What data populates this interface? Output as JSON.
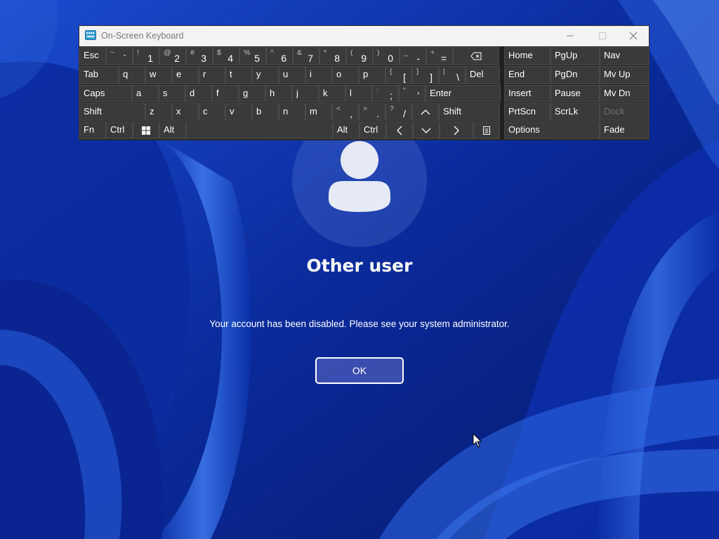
{
  "window": {
    "title": "On-Screen Keyboard",
    "icon": "keyboard-icon",
    "controls": [
      "minimize-icon",
      "maximize-icon",
      "close-icon"
    ]
  },
  "keyboard": {
    "rows": [
      [
        {
          "id": "esc",
          "label": "Esc"
        },
        {
          "id": "backtick",
          "shift": "~",
          "label": "`"
        },
        {
          "id": "1",
          "shift": "!",
          "label": "1"
        },
        {
          "id": "2",
          "shift": "@",
          "label": "2"
        },
        {
          "id": "3",
          "shift": "#",
          "label": "3"
        },
        {
          "id": "4",
          "shift": "$",
          "label": "4"
        },
        {
          "id": "5",
          "shift": "%",
          "label": "5"
        },
        {
          "id": "6",
          "shift": "^",
          "label": "6"
        },
        {
          "id": "7",
          "shift": "&",
          "label": "7"
        },
        {
          "id": "8",
          "shift": "*",
          "label": "8"
        },
        {
          "id": "9",
          "shift": "(",
          "label": "9"
        },
        {
          "id": "0",
          "shift": ")",
          "label": "0"
        },
        {
          "id": "minus",
          "shift": "_",
          "label": "-"
        },
        {
          "id": "equals",
          "shift": "+",
          "label": "="
        },
        {
          "id": "backspace",
          "icon": "backspace-icon"
        },
        {
          "id": "home",
          "label": "Home"
        },
        {
          "id": "pgup",
          "label": "PgUp"
        },
        {
          "id": "nav",
          "label": "Nav"
        }
      ],
      [
        {
          "id": "tab",
          "label": "Tab"
        },
        {
          "id": "q",
          "label": "q"
        },
        {
          "id": "w",
          "label": "w"
        },
        {
          "id": "e",
          "label": "e"
        },
        {
          "id": "r",
          "label": "r"
        },
        {
          "id": "t",
          "label": "t"
        },
        {
          "id": "y",
          "label": "y"
        },
        {
          "id": "u",
          "label": "u"
        },
        {
          "id": "i",
          "label": "i"
        },
        {
          "id": "o",
          "label": "o"
        },
        {
          "id": "p",
          "label": "p"
        },
        {
          "id": "lbracket",
          "shift": "{",
          "label": "["
        },
        {
          "id": "rbracket",
          "shift": "}",
          "label": "]"
        },
        {
          "id": "backslash",
          "shift": "|",
          "label": "\\"
        },
        {
          "id": "del",
          "label": "Del"
        },
        {
          "id": "end",
          "label": "End"
        },
        {
          "id": "pgdn",
          "label": "PgDn"
        },
        {
          "id": "mvup",
          "label": "Mv Up"
        }
      ],
      [
        {
          "id": "caps",
          "label": "Caps"
        },
        {
          "id": "a",
          "label": "a"
        },
        {
          "id": "s",
          "label": "s"
        },
        {
          "id": "d",
          "label": "d"
        },
        {
          "id": "f",
          "label": "f"
        },
        {
          "id": "g",
          "label": "g"
        },
        {
          "id": "h",
          "label": "h"
        },
        {
          "id": "j",
          "label": "j"
        },
        {
          "id": "k",
          "label": "k"
        },
        {
          "id": "l",
          "label": "l"
        },
        {
          "id": "semicolon",
          "shift": ":",
          "label": ";"
        },
        {
          "id": "quote",
          "shift": "\"",
          "label": "'"
        },
        {
          "id": "enter",
          "label": "Enter"
        },
        {
          "id": "insert",
          "label": "Insert"
        },
        {
          "id": "pause",
          "label": "Pause"
        },
        {
          "id": "mvdn",
          "label": "Mv Dn"
        }
      ],
      [
        {
          "id": "lshift",
          "label": "Shift"
        },
        {
          "id": "z",
          "label": "z"
        },
        {
          "id": "x",
          "label": "x"
        },
        {
          "id": "c",
          "label": "c"
        },
        {
          "id": "v",
          "label": "v"
        },
        {
          "id": "b",
          "label": "b"
        },
        {
          "id": "n",
          "label": "n"
        },
        {
          "id": "m",
          "label": "m"
        },
        {
          "id": "comma",
          "shift": "<",
          "label": ","
        },
        {
          "id": "period",
          "shift": ">",
          "label": "."
        },
        {
          "id": "slash",
          "shift": "?",
          "label": "/"
        },
        {
          "id": "up",
          "icon": "arrow-up-icon"
        },
        {
          "id": "rshift",
          "label": "Shift"
        },
        {
          "id": "prtscn",
          "label": "PrtScn"
        },
        {
          "id": "scrlk",
          "label": "ScrLk"
        },
        {
          "id": "dock",
          "label": "Dock",
          "disabled": true
        }
      ],
      [
        {
          "id": "fn",
          "label": "Fn"
        },
        {
          "id": "lctrl",
          "label": "Ctrl"
        },
        {
          "id": "win",
          "icon": "windows-logo-icon"
        },
        {
          "id": "lalt",
          "label": "Alt"
        },
        {
          "id": "space",
          "label": ""
        },
        {
          "id": "ralt",
          "label": "Alt"
        },
        {
          "id": "rctrl",
          "label": "Ctrl"
        },
        {
          "id": "left",
          "icon": "arrow-left-icon"
        },
        {
          "id": "down",
          "icon": "arrow-down-icon"
        },
        {
          "id": "right",
          "icon": "arrow-right-icon"
        },
        {
          "id": "menu",
          "icon": "context-menu-icon"
        },
        {
          "id": "options",
          "label": "Options"
        },
        {
          "id": "fade",
          "label": "Fade"
        }
      ]
    ]
  },
  "login": {
    "avatar_icon": "user-avatar-icon",
    "username": "Other user",
    "message": "Your account has been disabled.  Please see your system administrator.",
    "ok_label": "OK"
  },
  "colors": {
    "wallpaper_deep": "#061a6e",
    "wallpaper_light": "#2b5fe0",
    "key_bg": "#3a3a3a",
    "osk_bg": "#202020",
    "titlebar_bg": "#f3f3f3"
  }
}
